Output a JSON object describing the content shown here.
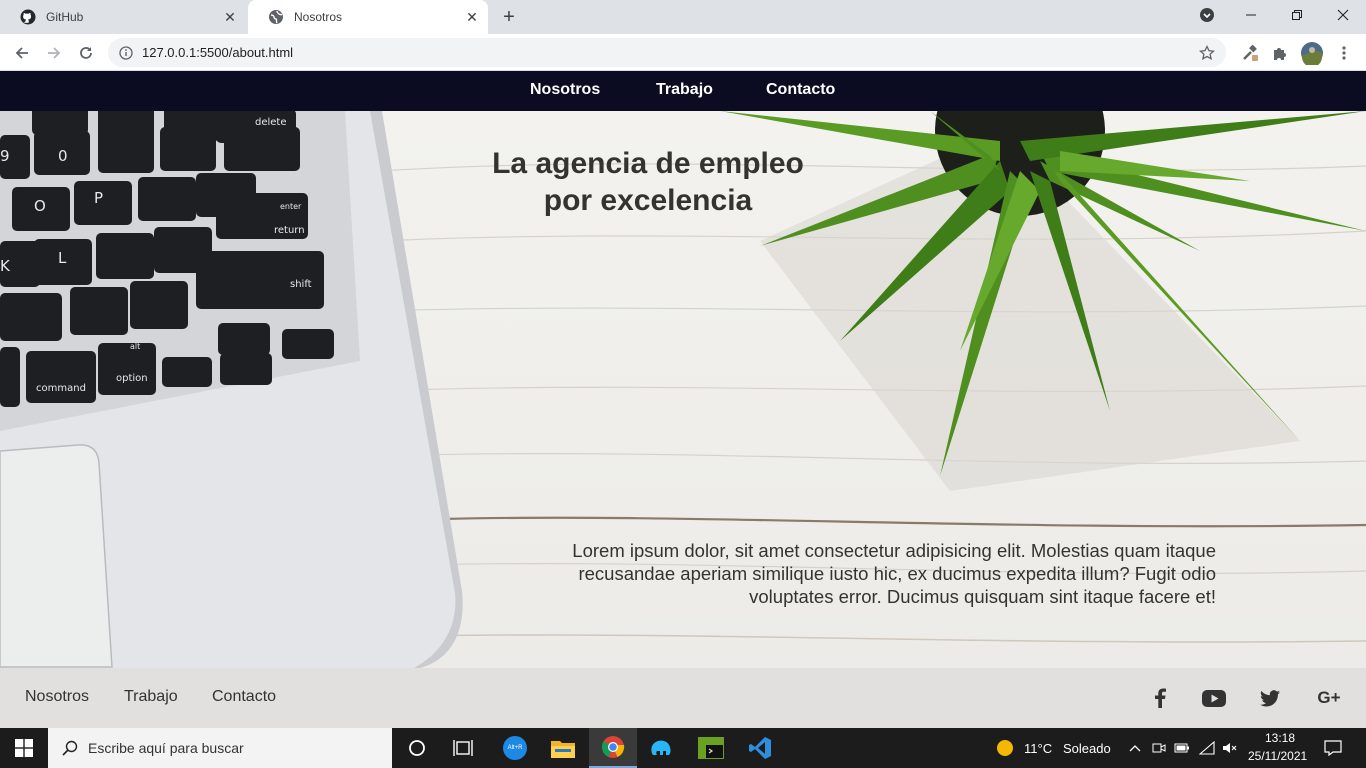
{
  "browser": {
    "tabs": [
      {
        "title": "GitHub",
        "active": false
      },
      {
        "title": "Nosotros",
        "active": true
      }
    ],
    "url": "127.0.0.1:5500/about.html"
  },
  "navbar": {
    "items": [
      "Nosotros",
      "Trabajo",
      "Contacto"
    ]
  },
  "hero": {
    "title_line1": "La agencia de empleo",
    "title_line2": "por excelencia",
    "text_line1": "Lorem ipsum dolor, sit amet consectetur adipisicing elit. Molestias quam itaque",
    "text_line2": "recusandae aperiam similique iusto hic, ex ducimus expedita illum? Fugit odio",
    "text_line3": "voluptates error. Ducimus quisquam sint itaque facere et!",
    "keyboard_labels": {
      "delete": "delete",
      "enter": "enter",
      "return": "return",
      "shift": "shift",
      "command": "command",
      "option": "option",
      "alt": "alt",
      "k0": "0",
      "kO": "O",
      "kP": "P",
      "kK": "K",
      "kL": "L",
      "k9": "9"
    }
  },
  "footer": {
    "links": [
      "Nosotros",
      "Trabajo",
      "Contacto"
    ],
    "social_icons": [
      "facebook-icon",
      "youtube-icon",
      "twitter-icon",
      "google-plus-icon"
    ],
    "google_plus_label": "G+"
  },
  "taskbar": {
    "search_placeholder": "Escribe aquí para buscar",
    "weather_temp": "11°C",
    "weather_desc": "Soleado",
    "time": "13:18",
    "date": "25/11/2021",
    "app_label_keys": "Alt+R"
  },
  "colors": {
    "navbar_bg": "#0b0c22",
    "footer_bg": "#e1e0df",
    "text_dark": "#33332f",
    "vscode_blue": "#2f8fdd",
    "plant_green": "#4f8f1f"
  }
}
